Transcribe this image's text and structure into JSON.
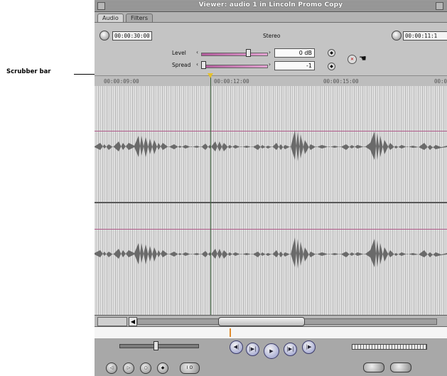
{
  "callout": {
    "label": "Scrubber bar"
  },
  "window": {
    "title": "Viewer: audio 1 in Lincoln Promo Copy"
  },
  "tabs": [
    {
      "label": "Audio",
      "active": true
    },
    {
      "label": "Filters",
      "active": false
    }
  ],
  "controls": {
    "duration_timecode": "00:00:30:00",
    "channel_mode": "Stereo",
    "current_timecode": "00:00:11:1",
    "level_label": "Level",
    "level_value": "0 dB",
    "level_fraction": 0.72,
    "spread_label": "Spread",
    "spread_value": "-1",
    "spread_fraction": 0.0
  },
  "ruler": {
    "times": [
      "00:00:09:00",
      "00:00:12:00",
      "00:00:15:00",
      "00:0"
    ]
  },
  "scroll": {
    "position_fraction": 0.38
  },
  "colors": {
    "level_line": "#b05a8a",
    "transport_accent": "#8f95c8",
    "playhead_marker": "#e6c12c"
  },
  "transport": {
    "buttons": [
      {
        "name": "previous-edit",
        "glyph": "◀|"
      },
      {
        "name": "play-in-to-out",
        "glyph": "|▶|"
      },
      {
        "name": "play",
        "glyph": "▶"
      },
      {
        "name": "play-around",
        "glyph": "|▶|"
      },
      {
        "name": "next-edit",
        "glyph": "|▶"
      }
    ],
    "bottom_left_buttons": [
      {
        "name": "mark-in",
        "glyph": "◁"
      },
      {
        "name": "mark-out",
        "glyph": "▷"
      },
      {
        "name": "mark-clip",
        "glyph": "○"
      },
      {
        "name": "add-marker",
        "glyph": "◆"
      },
      {
        "name": "in-out-points",
        "glyph": "I O"
      }
    ]
  }
}
